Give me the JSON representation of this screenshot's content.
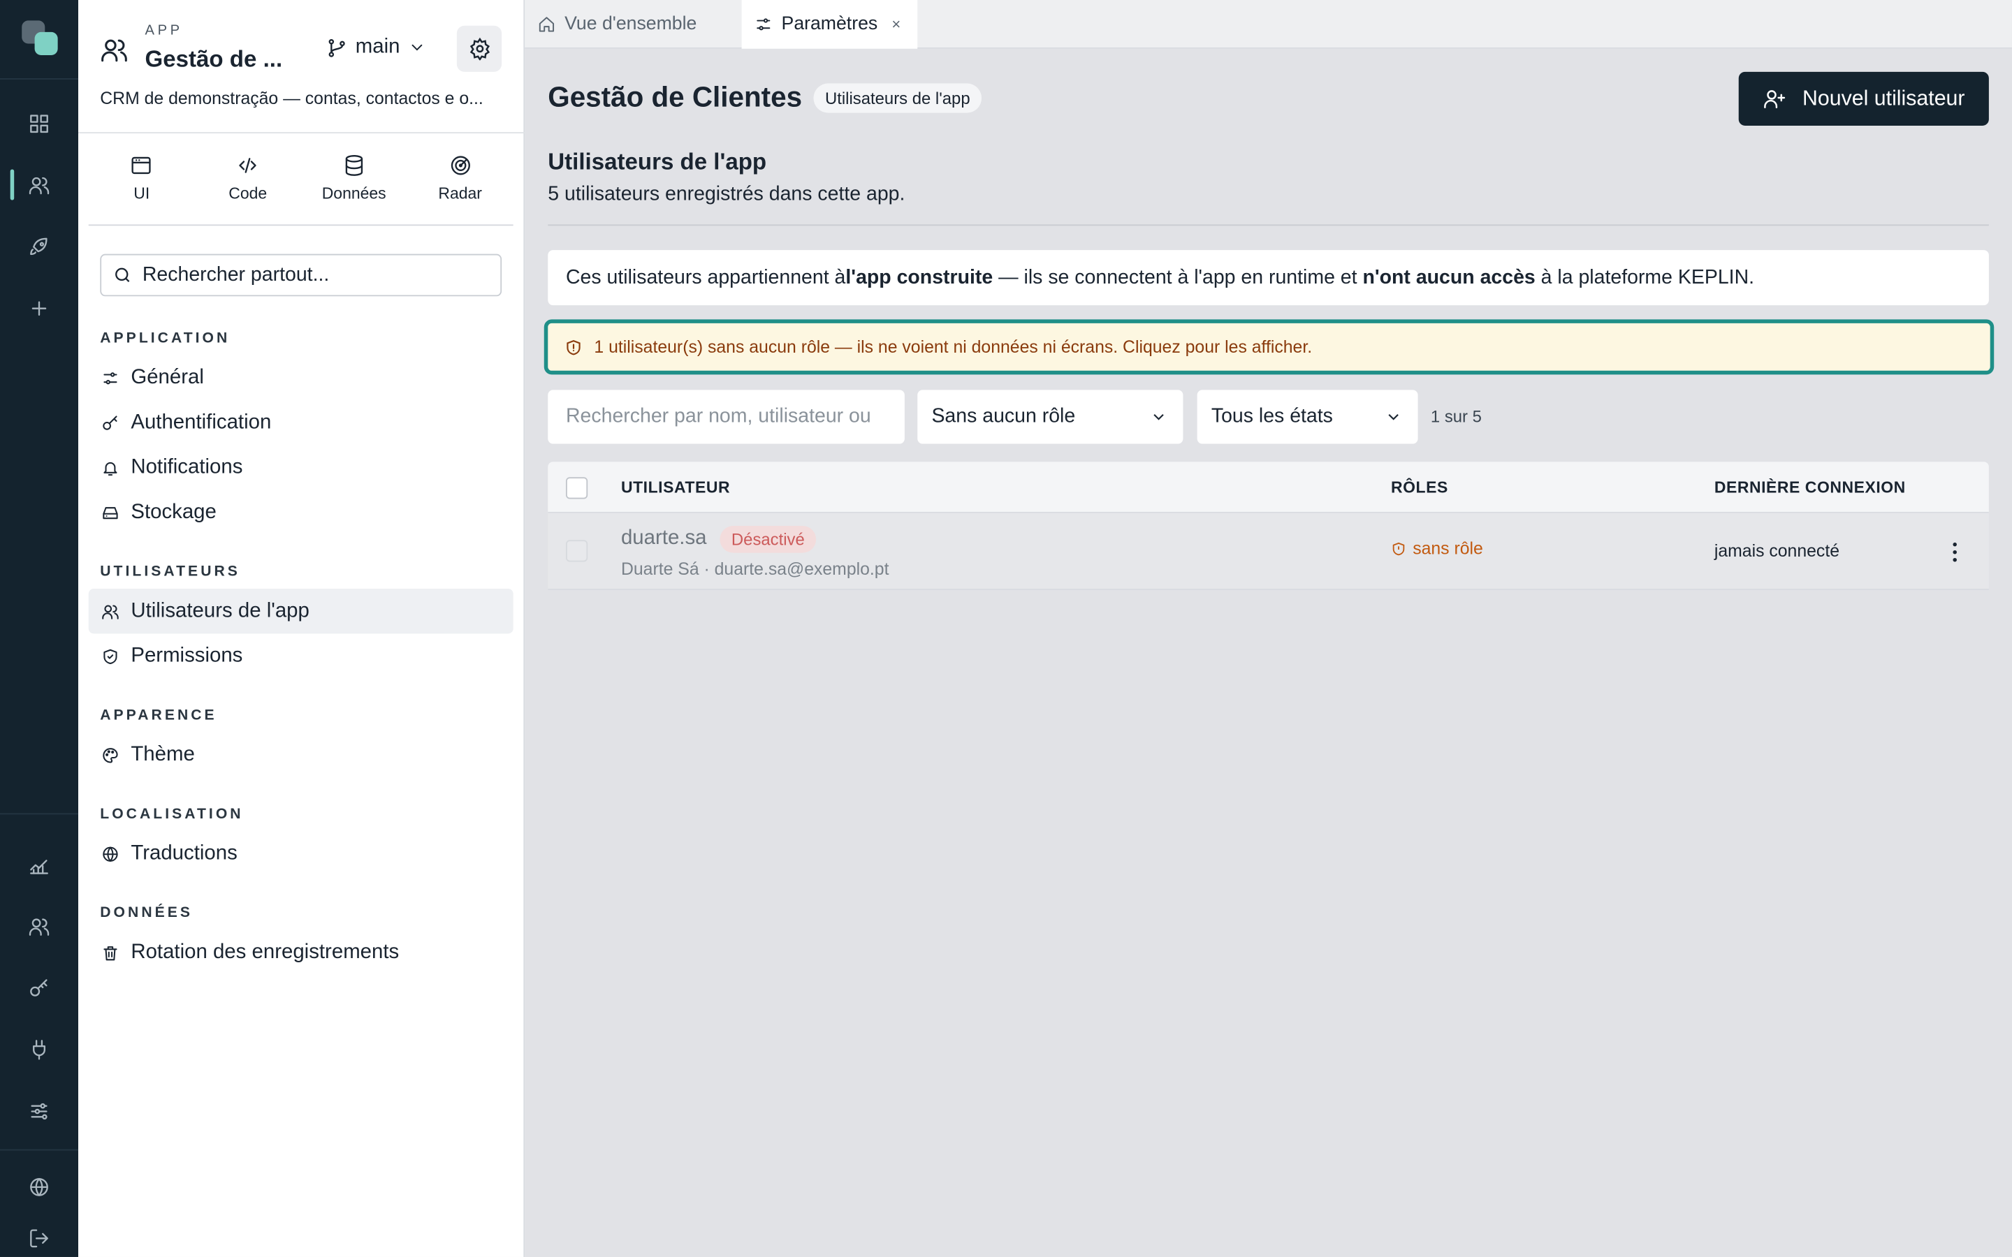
{
  "tabs": [
    {
      "label": "Vue d'ensemble",
      "icon": "home-icon"
    },
    {
      "label": "Paramètres",
      "icon": "sliders-icon",
      "close": "×"
    }
  ],
  "app": {
    "kicker": "APP",
    "name": "Gestão de ...",
    "branch": "main",
    "description": "CRM de demonstração — contas, contactos e o..."
  },
  "mode_tabs": [
    {
      "label": "UI",
      "icon": "window-icon"
    },
    {
      "label": "Code",
      "icon": "code-icon"
    },
    {
      "label": "Données",
      "icon": "database-icon"
    },
    {
      "label": "Radar",
      "icon": "radar-icon"
    }
  ],
  "search": {
    "placeholder": "Rechercher partout..."
  },
  "nav": {
    "application": {
      "title": "APPLICATION",
      "items": [
        "Général",
        "Authentification",
        "Notifications",
        "Stockage"
      ]
    },
    "users": {
      "title": "UTILISATEURS",
      "items": [
        "Utilisateurs de l'app",
        "Permissions"
      ]
    },
    "appearance": {
      "title": "APPARENCE",
      "items": [
        "Thème"
      ]
    },
    "localisation": {
      "title": "LOCALISATION",
      "items": [
        "Traductions"
      ]
    },
    "data": {
      "title": "DONNÉES",
      "items": [
        "Rotation des enregistrements"
      ]
    }
  },
  "page": {
    "title": "Gestão de Clientes",
    "badge": "Utilisateurs de l'app",
    "new_user_button": "Nouvel utilisateur",
    "section_title": "Utilisateurs de l'app",
    "section_subtitle": "5 utilisateurs enregistrés dans cette app.",
    "info": {
      "p1": "Ces utilisateurs appartiennent à ",
      "b1": "l'app construite",
      "p2": " — ils se connectent à l'app en runtime et ",
      "b2": "n'ont aucun accès",
      "p3": " à la plateforme KEPLIN."
    },
    "warning": "1 utilisateur(s) sans aucun rôle — ils ne voient ni données ni écrans. Cliquez pour les afficher."
  },
  "filters": {
    "search_placeholder": "Rechercher par nom, utilisateur ou",
    "role": "Sans aucun rôle",
    "status": "Tous les états",
    "count": "1 sur 5"
  },
  "table": {
    "headers": {
      "user": "UTILISATEUR",
      "roles": "RÔLES",
      "last_login": "DERNIÈRE CONNEXION"
    },
    "rows": [
      {
        "username": "duarte.sa",
        "status": "Désactivé",
        "meta": "Duarte Sá · duarte.sa@exemplo.pt",
        "role": "sans rôle",
        "last_login": "jamais connecté"
      }
    ]
  },
  "colors": {
    "rail_bg": "#14232e",
    "accent": "#7fd1c4",
    "primary_button": "#14232e",
    "warning_border": "#1f8f88",
    "warning_bg": "#fdf7e1",
    "warning_text": "#8a3b0d",
    "disabled_badge": "#cc5a5a",
    "role_warning": "#c25a10"
  }
}
